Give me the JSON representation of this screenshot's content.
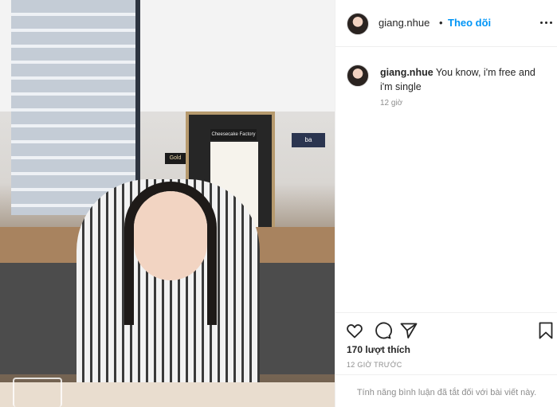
{
  "post": {
    "username": "giang.nhue",
    "separator": "•",
    "follow_label": "Theo dõi",
    "more_icon": "more-options-icon"
  },
  "photo": {
    "signs": {
      "bakery": "Cheesecake Factory",
      "gold": "Gold",
      "shop": "ba"
    }
  },
  "caption": {
    "username": "giang.nhue",
    "text": "You know, i'm free and i'm single",
    "time": "12 giờ"
  },
  "actions": {
    "like_icon": "heart-icon",
    "comment_icon": "comment-icon",
    "share_icon": "share-icon",
    "save_icon": "bookmark-icon"
  },
  "stats": {
    "likes": "170 lượt thích",
    "posted_time": "12 GIỜ TRƯỚC"
  },
  "comments_disabled_text": "Tính năng bình luận đã tắt đối với bài viết này.",
  "colors": {
    "link": "#0095f6",
    "text": "#262626",
    "muted": "#8e8e8e",
    "border": "#efefef"
  }
}
